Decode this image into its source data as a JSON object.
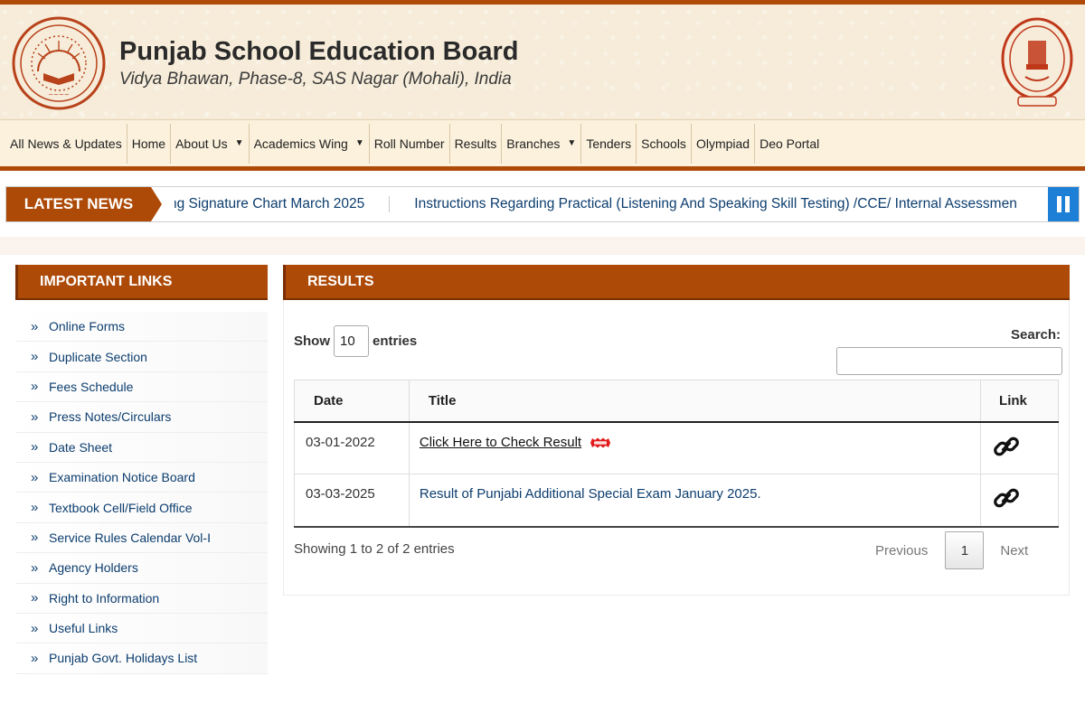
{
  "header": {
    "title": "Punjab School Education Board",
    "address": "Vidya Bhawan, Phase-8, SAS Nagar (Mohali), India"
  },
  "nav": {
    "items": [
      {
        "label": "All News & Updates",
        "dropdown": false
      },
      {
        "label": "Home",
        "dropdown": false
      },
      {
        "label": "About Us",
        "dropdown": true
      },
      {
        "label": "Academics Wing",
        "dropdown": true
      },
      {
        "label": "Roll Number",
        "dropdown": false
      },
      {
        "label": "Results",
        "dropdown": false
      },
      {
        "label": "Branches",
        "dropdown": true
      },
      {
        "label": "Tenders",
        "dropdown": false
      },
      {
        "label": "Schools",
        "dropdown": false
      },
      {
        "label": "Olympiad",
        "dropdown": false
      },
      {
        "label": "Deo Portal",
        "dropdown": false
      }
    ]
  },
  "news": {
    "label": "LATEST NEWS",
    "items": [
      "ng Signature Chart March 2025",
      "Instructions Regarding Practical (Listening And Speaking Skill Testing) /CCE/ Internal Assessmen"
    ],
    "pause_icon": "pause-icon"
  },
  "sidebar": {
    "heading": "IMPORTANT LINKS",
    "bullet": "»",
    "links": [
      "Online Forms",
      "Duplicate Section",
      "Fees Schedule",
      "Press Notes/Circulars",
      "Date Sheet",
      "Examination Notice Board",
      "Textbook Cell/Field Office",
      "Service Rules Calendar Vol-I",
      "Agency Holders",
      "Right to Information",
      "Useful Links",
      "Punjab Govt. Holidays List"
    ]
  },
  "results": {
    "heading": "RESULTS",
    "show_label": "Show",
    "entries_value": "10",
    "entries_label": "entries",
    "search_label": "Search:",
    "search_value": "",
    "columns": [
      "Date",
      "Title",
      "Link"
    ],
    "rows": [
      {
        "date": "03-01-2022",
        "title": "Click Here to Check Result",
        "badge": "new-badge-icon",
        "link_icon": "link-icon"
      },
      {
        "date": "03-03-2025",
        "title": "Result of Punjabi Additional Special Exam January 2025.",
        "badge": "",
        "link_icon": "link-icon"
      }
    ],
    "info": "Showing 1 to 2 of 2 entries",
    "pagination": {
      "previous": "Previous",
      "current": "1",
      "next": "Next"
    }
  },
  "colors": {
    "brand": "#ad4a07",
    "link": "#0c3d6e",
    "pause_button": "#1e7fd6",
    "header_bg": "#f6ecd9"
  }
}
